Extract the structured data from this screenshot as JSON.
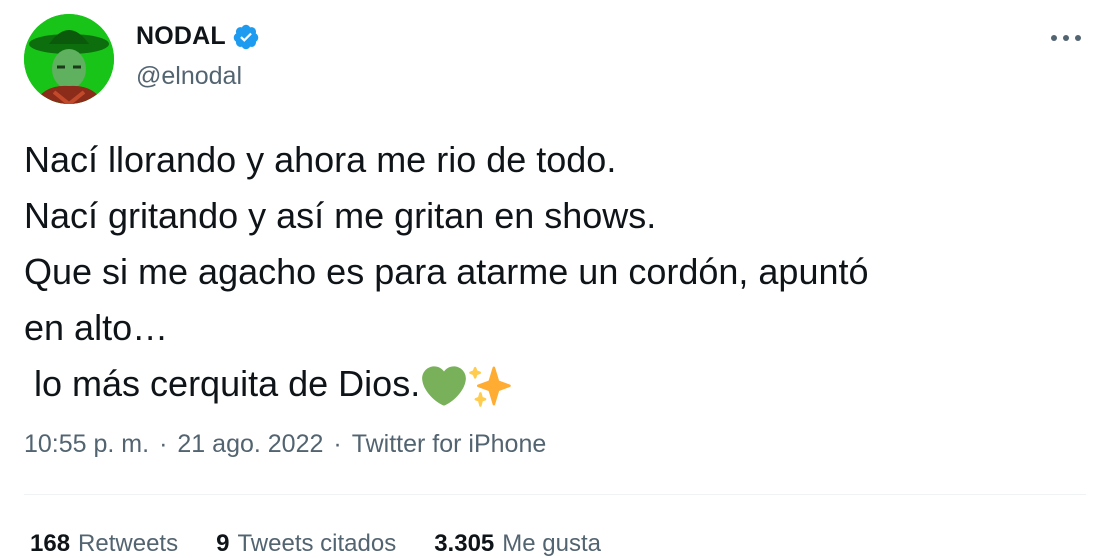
{
  "author": {
    "name": "NODAL",
    "handle": "@elnodal",
    "verified": true,
    "avatar_icon": "profile-photo-green-cowboy-hat"
  },
  "tweet": {
    "lines": [
      "Nací llorando y ahora me rio de todo.",
      "Nací gritando y así me gritan en shows.",
      "Que si me agacho es para atarme un cordón, apuntó",
      "en alto…",
      " lo más cerquita de Dios."
    ],
    "emojis": [
      "green-heart-icon",
      "sparkles-icon"
    ]
  },
  "meta": {
    "time": "10:55 p. m.",
    "sep1": "·",
    "date": "21 ago. 2022",
    "sep2": "·",
    "source": "Twitter for iPhone"
  },
  "stats": {
    "retweets_count": "168",
    "retweets_label": "Retweets",
    "quotes_count": "9",
    "quotes_label": "Tweets citados",
    "likes_count": "3.305",
    "likes_label": "Me gusta"
  },
  "colors": {
    "text": "#0f1419",
    "secondary": "#536471",
    "verified": "#1d9bf0",
    "heart": "#78b159",
    "sparkle": "#ffac33"
  }
}
